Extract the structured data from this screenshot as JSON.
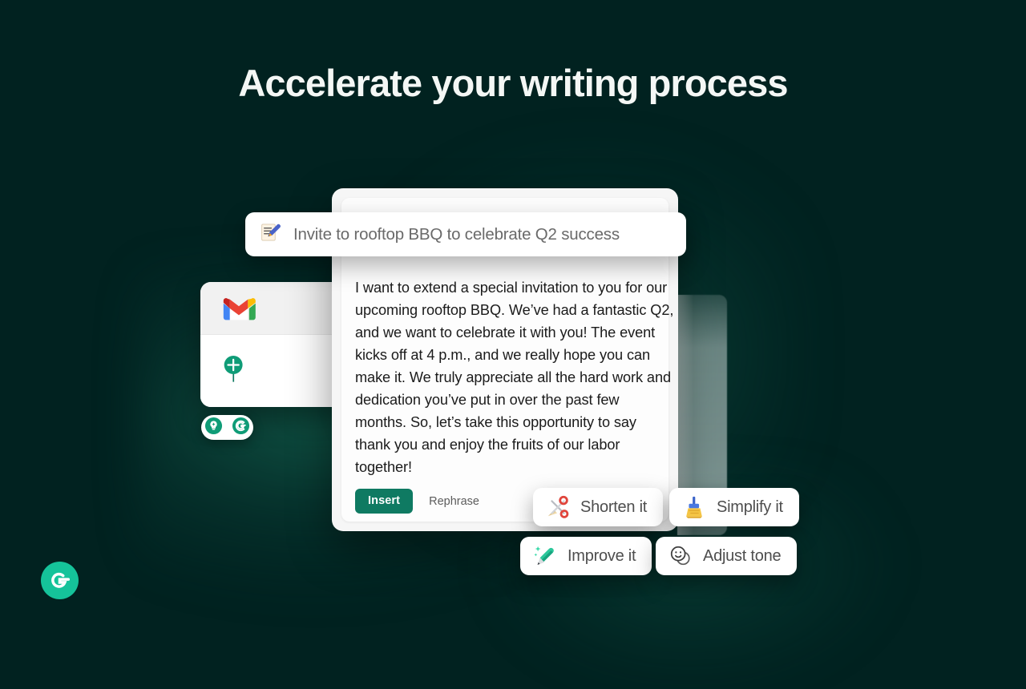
{
  "page": {
    "background_color": "#012220",
    "headline": "Accelerate your writing process"
  },
  "brand": {
    "name": "grammarly-logo",
    "color": "#15c39a"
  },
  "gmail_card": {
    "app_icon": "gmail-logo",
    "secondary_icon": "green-pin-icon"
  },
  "mini_toolbar": {
    "icons": [
      "lightbulb-icon",
      "grammarly-g-icon"
    ]
  },
  "prompt_bar": {
    "icon": "memo-pen-icon",
    "value": "Invite to rooftop BBQ to celebrate Q2 success",
    "placeholder": "Invite to rooftop BBQ to celebrate Q2 success"
  },
  "assistant_card": {
    "composed_text": "I want to extend a special invitation to you for our upcoming rooftop BBQ. We’ve had a fantastic Q2, and we want to celebrate it with you! The event kicks off at 4 p.m., and we really hope you can make it. We truly appreciate all the hard work and dedication you’ve put in over the past few months. So, let’s take this opportunity to say thank you and enjoy the fruits of our labor together!",
    "insert_label": "Insert",
    "insert_color": "#0f7a62",
    "rephrase_label": "Rephrase"
  },
  "suggestion_chips": [
    {
      "id": "shorten",
      "label": "Shorten it",
      "icon": "scissors-icon"
    },
    {
      "id": "simplify",
      "label": "Simplify it",
      "icon": "broom-icon"
    },
    {
      "id": "improve",
      "label": "Improve it",
      "icon": "sparkle-crayon-icon"
    },
    {
      "id": "tone",
      "label": "Adjust tone",
      "icon": "smiley-faces-icon"
    }
  ]
}
